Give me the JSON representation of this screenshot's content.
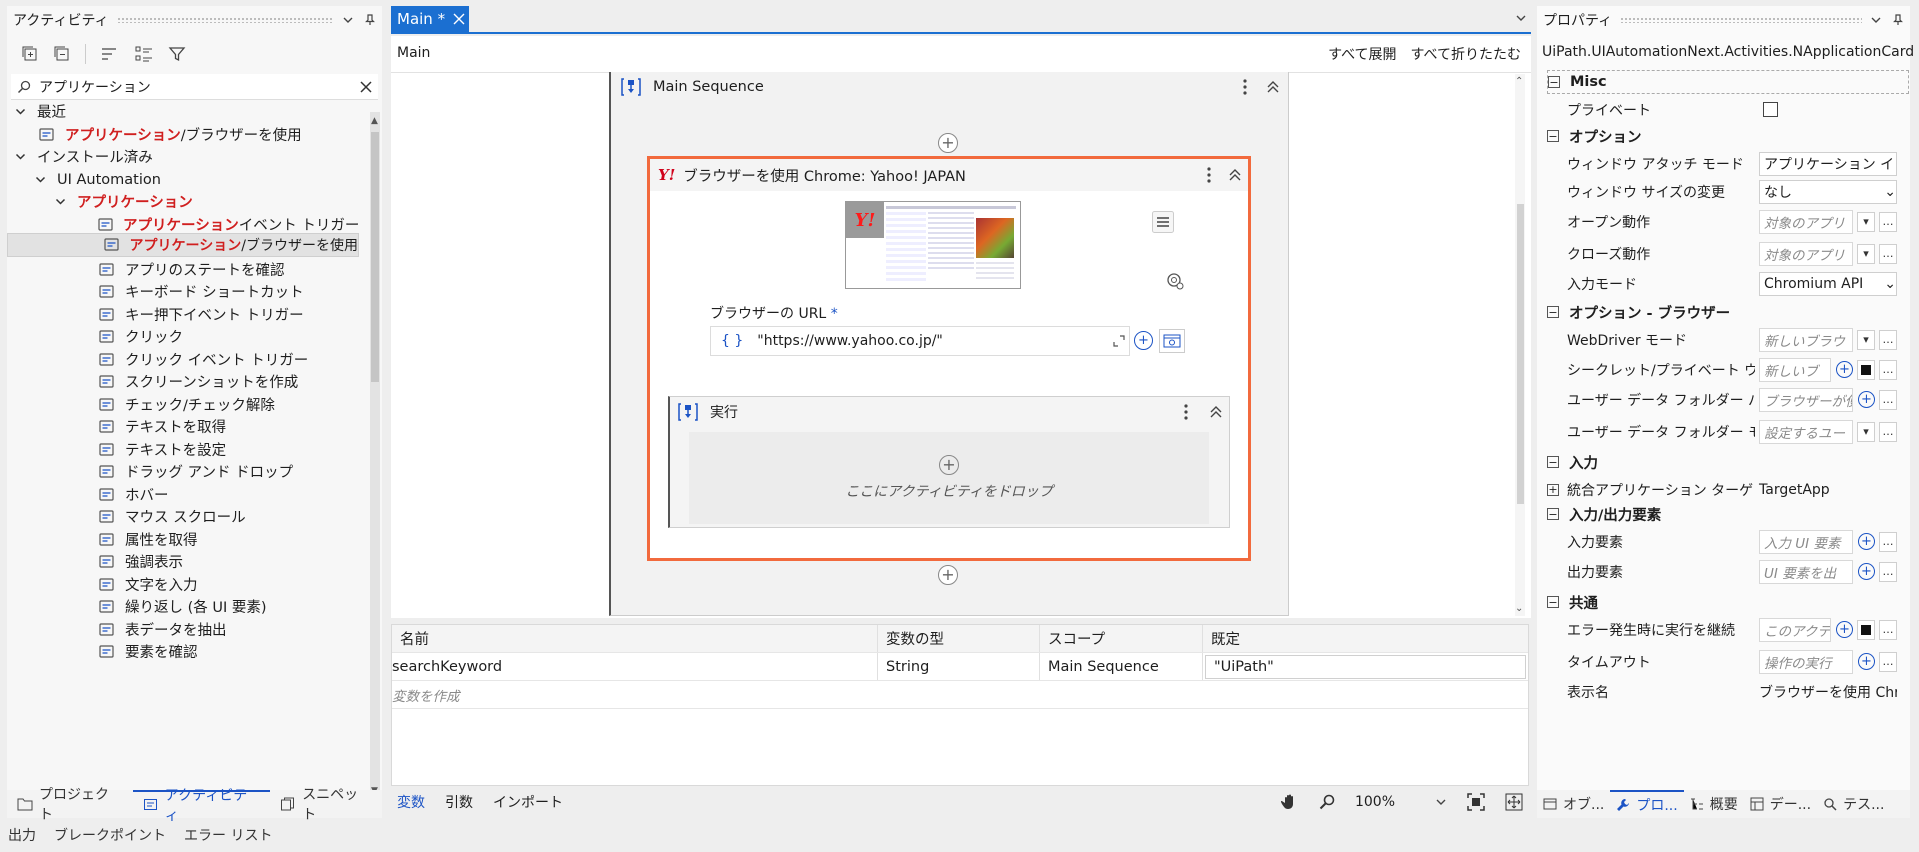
{
  "left_panel": {
    "title": "アクティビティ",
    "search_value": "アプリケーション",
    "tree": [
      {
        "chev": "v",
        "label": "最近",
        "icon": ""
      },
      {
        "chev": "",
        "hl": "アプリケーション",
        "label": "/ブラウザーを使用",
        "icon": "window-icon"
      },
      {
        "chev": "v",
        "label": "インストール済み",
        "icon": ""
      },
      {
        "chev": "v",
        "label": "UI Automation",
        "icon": ""
      },
      {
        "chev": "v",
        "hl": "アプリケーション",
        "label": "",
        "icon": ""
      },
      {
        "chev": "",
        "hl": "アプリケーション",
        "label": " イベント トリガー",
        "icon": "trigger-icon"
      },
      {
        "chev": "",
        "hl": "アプリケーション",
        "label": "/ブラウザーを使用",
        "icon": "window-icon",
        "selected": true
      },
      {
        "chev": "",
        "label": "アプリのステートを確認",
        "icon": "check-state-icon"
      },
      {
        "chev": "",
        "label": "キーボード ショートカット",
        "icon": "keyboard-icon"
      },
      {
        "chev": "",
        "label": "キー押下イベント トリガー",
        "icon": "keypress-icon"
      },
      {
        "chev": "",
        "label": "クリック",
        "icon": "click-icon"
      },
      {
        "chev": "",
        "label": "クリック イベント トリガー",
        "icon": "click-trigger-icon"
      },
      {
        "chev": "",
        "label": "スクリーンショットを作成",
        "icon": "screenshot-icon"
      },
      {
        "chev": "",
        "label": "チェック/チェック解除",
        "icon": "checkbox-icon"
      },
      {
        "chev": "",
        "label": "テキストを取得",
        "icon": "get-text-icon"
      },
      {
        "chev": "",
        "label": "テキストを設定",
        "icon": "set-text-icon"
      },
      {
        "chev": "",
        "label": "ドラッグ アンド ドロップ",
        "icon": "drag-icon"
      },
      {
        "chev": "",
        "label": "ホバー",
        "icon": "hover-icon"
      },
      {
        "chev": "",
        "label": "マウス スクロール",
        "icon": "scroll-icon"
      },
      {
        "chev": "",
        "label": "属性を取得",
        "icon": "attribute-icon"
      },
      {
        "chev": "",
        "label": "強調表示",
        "icon": "highlight-icon"
      },
      {
        "chev": "",
        "label": "文字を入力",
        "icon": "type-into-icon"
      },
      {
        "chev": "",
        "label": "繰り返し (各 UI 要素)",
        "icon": "loop-icon"
      },
      {
        "chev": "",
        "label": "表データを抽出",
        "icon": "table-icon"
      },
      {
        "chev": "",
        "label": "要素を確認",
        "icon": "check-element-icon"
      }
    ],
    "tabs": [
      "プロジェクト",
      "アクティビティ",
      "スニペット"
    ]
  },
  "center": {
    "tab_label": "Main *",
    "breadcrumb": "Main",
    "expand_all": "すべて展開",
    "collapse_all": "すべて折りたたむ",
    "sequence_title": "Main Sequence",
    "browser_title": "ブラウザーを使用 Chrome: Yahoo! JAPAN",
    "url_label": "ブラウザーの URL",
    "url_required": "*",
    "url_value": "\"https://www.yahoo.co.jp/\"",
    "exec_title": "実行",
    "drop_hint": "ここにアクティビティをドロップ",
    "yahoo_logo": "Y!"
  },
  "variables": {
    "headers": [
      "名前",
      "変数の型",
      "スコープ",
      "既定"
    ],
    "rows": [
      [
        "searchKeyword",
        "String",
        "Main Sequence",
        "\"UiPath\""
      ]
    ],
    "create_hint": "変数を作成"
  },
  "status_bar": {
    "tabs": [
      "変数",
      "引数",
      "インポート"
    ],
    "zoom": "100%"
  },
  "right_panel": {
    "title": "プロパティ",
    "activity_type": "UiPath.UIAutomationNext.Activities.NApplicationCard",
    "tabs": [
      "オブ...",
      "プロ...",
      "概要",
      "デー...",
      "テス..."
    ]
  },
  "props": {
    "misc": "Misc",
    "private": "プライベート",
    "options": "オプション",
    "window_attach_mode": "ウィンドウ アタッチ モード",
    "window_attach_mode_val": "アプリケーション イン",
    "window_resize": "ウィンドウ サイズの変更",
    "window_resize_val": "なし",
    "open_behavior": "オープン動作",
    "open_behavior_ph": "対象のアプリ",
    "close_behavior": "クローズ動作",
    "close_behavior_ph": "対象のアプリ",
    "input_mode": "入力モード",
    "input_mode_val": "Chromium API",
    "options_browser": "オプション - ブラウザー",
    "webdriver_mode": "WebDriver モード",
    "webdriver_mode_ph": "新しいブラウ",
    "incognito": "シークレット/プライベート ウィンドウ",
    "incognito_ph": "新しいブ",
    "user_data_path": "ユーザー データ フォルダー パス",
    "user_data_path_ph": "ブラウザーが使",
    "user_data_mode": "ユーザー データ フォルダー モード",
    "user_data_mode_ph": "設定するユー",
    "input": "入力",
    "unified_target": "統合アプリケーション ターゲット",
    "unified_target_val": "TargetApp",
    "io_elements": "入力/出力要素",
    "input_element": "入力要素",
    "input_element_ph": "入力 UI 要素",
    "output_element": "出力要素",
    "output_element_ph": "UI 要素を出",
    "common": "共通",
    "continue_on_error": "エラー発生時に実行を継続",
    "continue_on_error_ph": "このアクテ",
    "timeout": "タイムアウト",
    "timeout_ph": "操作の実行",
    "display_name": "表示名",
    "display_name_val": "ブラウザーを使用 Chrome"
  },
  "output_bar": [
    "出力",
    "ブレークポイント",
    "エラー リスト"
  ],
  "colors": {
    "accent": "#1b6fd1",
    "highlight": "#f26a3d",
    "match_text": "#d01f1f"
  }
}
